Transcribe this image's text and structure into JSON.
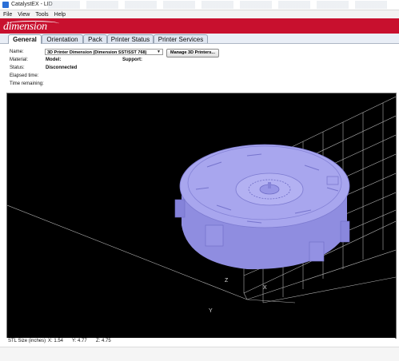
{
  "window": {
    "title": "CatalystEX - LID"
  },
  "menu": {
    "items": [
      "File",
      "View",
      "Tools",
      "Help"
    ]
  },
  "brand": {
    "logo_text": "dimension",
    "banner_color": "#c8102e"
  },
  "tabs": [
    {
      "label": "General",
      "active": true
    },
    {
      "label": "Orientation",
      "active": false
    },
    {
      "label": "Pack",
      "active": false
    },
    {
      "label": "Printer Status",
      "active": false
    },
    {
      "label": "Printer Services",
      "active": false
    }
  ],
  "info": {
    "name_label": "Name:",
    "printer_selected": "3D Printer Dimension  (Dimension SST/SST 768)",
    "manage_button": "Manage 3D Printers...",
    "material_label": "Material:",
    "model_label": "Model:",
    "support_label": "Support:",
    "status_label": "Status:",
    "status_value": "Disconnected",
    "elapsed_label": "Elapsed time:",
    "remaining_label": "Time remaining:"
  },
  "viewport": {
    "background": "#000000",
    "model_color": "#9a98e8",
    "grid_color": "#cfcfcf",
    "axis_labels": [
      "Z",
      "Y",
      "X"
    ]
  },
  "status_bar": {
    "stl_size_label": "STL Size (inches)",
    "x": "X: 1.54",
    "y": "Y: 4.77",
    "z": "Z: 4.75"
  }
}
